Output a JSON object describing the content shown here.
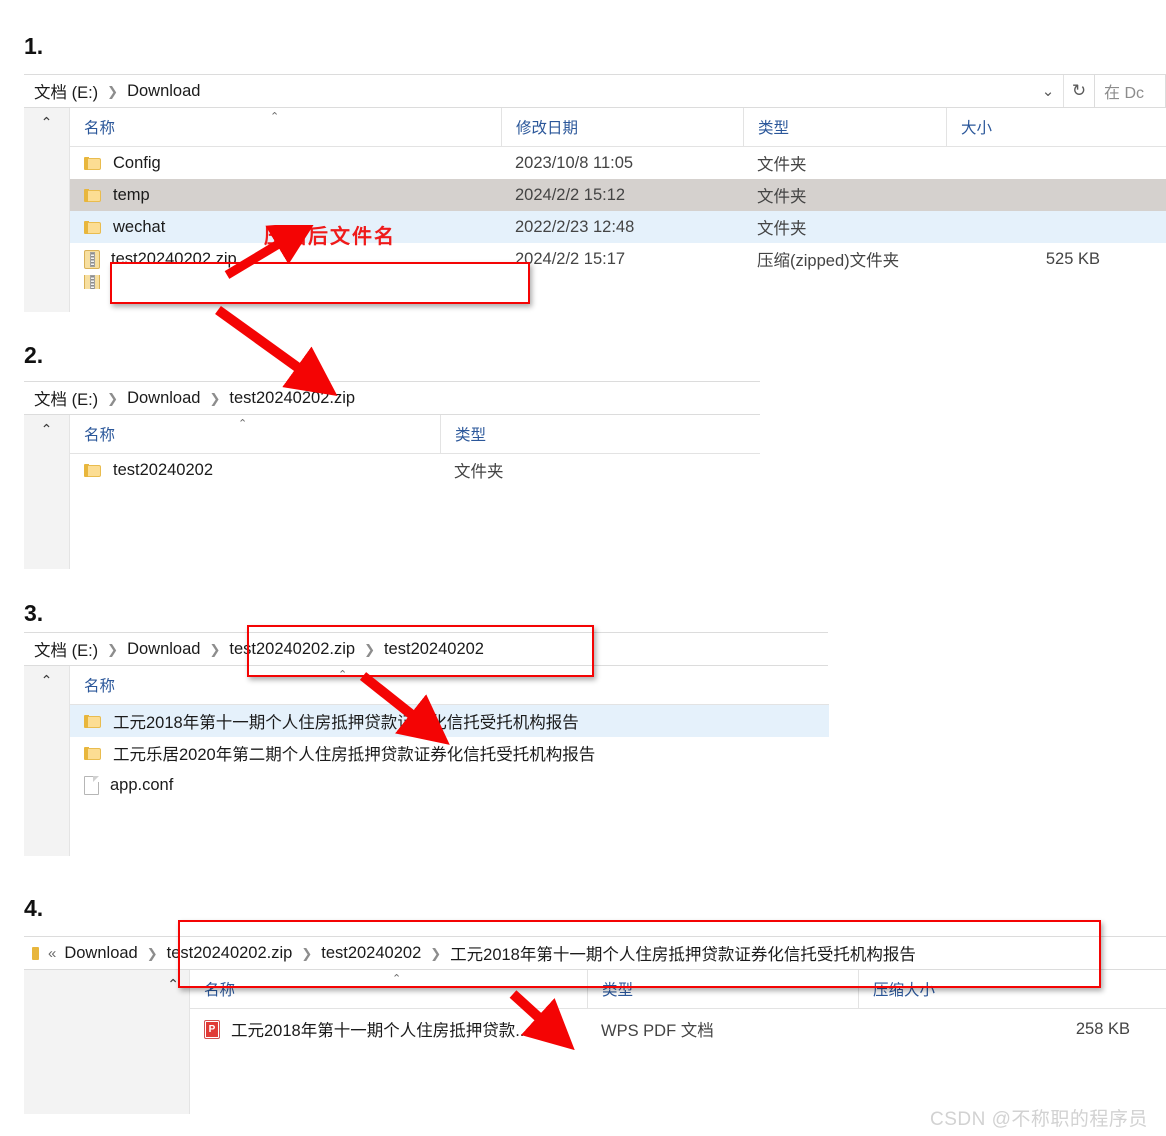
{
  "steps": {
    "s1": "1.",
    "s2": "2.",
    "s3": "3.",
    "s4": "4."
  },
  "annotations": {
    "zip_name_label": "压缩后文件名",
    "accent_red": "#f40404",
    "label_red": "#ef1a1a"
  },
  "watermark": "CSDN @不称职的程序员",
  "icons": {
    "chevron_down": "⌄",
    "refresh": "↻",
    "sort_asc": "⌃",
    "nav_chevron": "⌃",
    "crumb_sep": "❯",
    "crumb_overflow": "«"
  },
  "panel1": {
    "breadcrumb": [
      "文档 (E:)",
      "Download"
    ],
    "search_placeholder": "在 Download 中搜索",
    "search_visible_text": "在 Dc",
    "columns": [
      "名称",
      "修改日期",
      "类型",
      "大小"
    ],
    "sorted_column_index": 0,
    "rows": [
      {
        "name": "Config",
        "icon": "folder-icon",
        "date": "2023/10/8 11:05",
        "type": "文件夹",
        "size": "",
        "state": "normal"
      },
      {
        "name": "temp",
        "icon": "folder-icon",
        "date": "2024/2/2 15:12",
        "type": "文件夹",
        "size": "",
        "state": "sel-gray"
      },
      {
        "name": "wechat",
        "icon": "folder-icon",
        "date": "2022/2/23 12:48",
        "type": "文件夹",
        "size": "",
        "state": "sel-blue"
      },
      {
        "name": "test20240202.zip",
        "icon": "zip-icon",
        "date": "2024/2/2 15:17",
        "type": "压缩(zipped)文件夹",
        "size": "525 KB",
        "state": "normal"
      }
    ]
  },
  "panel2": {
    "breadcrumb": [
      "文档 (E:)",
      "Download",
      "test20240202.zip"
    ],
    "columns": [
      "名称",
      "类型"
    ],
    "rows": [
      {
        "name": "test20240202",
        "icon": "folder-icon",
        "type": "文件夹",
        "state": "normal"
      }
    ]
  },
  "panel3": {
    "breadcrumb": [
      "文档 (E:)",
      "Download",
      "test20240202.zip",
      "test20240202"
    ],
    "columns": [
      "名称"
    ],
    "rows": [
      {
        "name": "工元2018年第十一期个人住房抵押贷款证券化信托受托机构报告",
        "icon": "folder-icon",
        "state": "sel-blue"
      },
      {
        "name": "工元乐居2020年第二期个人住房抵押贷款证券化信托受托机构报告",
        "icon": "folder-icon",
        "state": "normal"
      },
      {
        "name": "app.conf",
        "icon": "file-icon",
        "state": "normal"
      }
    ]
  },
  "panel4": {
    "breadcrumb": [
      "«",
      "Download",
      "test20240202.zip",
      "test20240202",
      "工元2018年第十一期个人住房抵押贷款证券化信托受托机构报告"
    ],
    "columns": [
      "名称",
      "类型",
      "压缩大小"
    ],
    "rows": [
      {
        "name": "工元2018年第十一期个人住房抵押贷款...",
        "icon": "pdf-icon",
        "type": "WPS PDF 文档",
        "size": "258 KB",
        "state": "normal"
      }
    ]
  }
}
